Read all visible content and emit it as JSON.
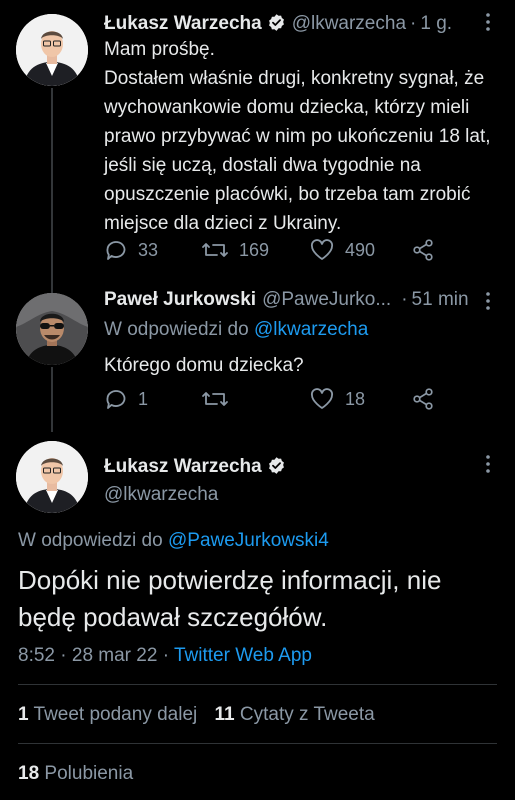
{
  "tweet1": {
    "name": "Łukasz Warzecha",
    "handle": "@lkwarzecha",
    "time": "1 g.",
    "text": "Mam prośbę.\nDostałem właśnie drugi, konkretny sygnał, że wychowankowie domu dziecka, którzy mieli prawo przybywać w nim po ukończeniu 18 lat, jeśli się uczą, dostali dwa tygodnie na opuszczenie placówki, bo trzeba tam zrobić miejsce dla dzieci z Ukrainy.",
    "replies": "33",
    "retweets": "169",
    "likes": "490"
  },
  "tweet2": {
    "name": "Paweł Jurkowski",
    "handle": "@PaweJurko...",
    "time": "51 min",
    "reply_prefix": "W odpowiedzi do",
    "reply_mention": "@lkwarzecha",
    "text": "Którego domu dziecka?",
    "replies": "1",
    "retweets": "",
    "likes": "18"
  },
  "tweet3": {
    "name": "Łukasz Warzecha",
    "handle": "@lkwarzecha",
    "reply_prefix": "W odpowiedzi do",
    "reply_mention": "@PaweJurkowski4",
    "text": "Dopóki nie potwierdzę informacji, nie będę podawał szczegółów.",
    "time": "8:52",
    "date": "28 mar 22",
    "source": "Twitter Web App",
    "retweet_count": "1",
    "retweet_label": "Tweet podany dalej",
    "quote_count": "11",
    "quote_label": "Cytaty z Tweeta",
    "like_count": "18",
    "like_label": "Polubienia"
  },
  "colors": {
    "background": "#000000",
    "text": "#e7e9ea",
    "secondary": "#8b98a5",
    "accent": "#1d9bf0"
  },
  "icons": [
    "verified-icon",
    "more-icon",
    "reply-icon",
    "retweet-icon",
    "like-icon",
    "share-icon"
  ]
}
